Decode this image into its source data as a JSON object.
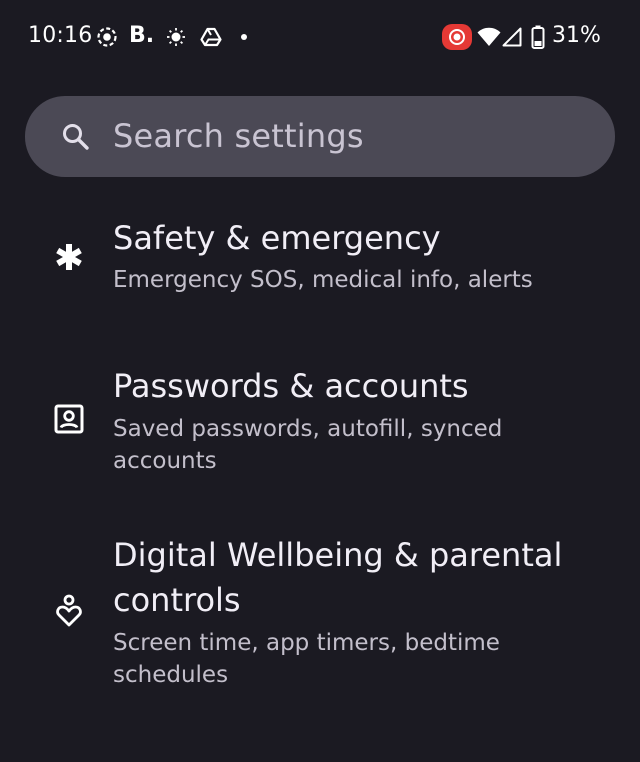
{
  "status_bar": {
    "time": "10:16",
    "app_letter": "B.",
    "battery_percent": "31%",
    "icons": [
      "record-circle-icon",
      "b-app-icon",
      "brightness-icon",
      "drive-icon",
      "notification-dot-icon",
      "screen-record-icon",
      "wifi-icon",
      "cell-signal-icon",
      "battery-icon"
    ]
  },
  "search": {
    "placeholder": "Search settings",
    "icon": "search-icon"
  },
  "items": [
    {
      "icon": "asterisk-icon",
      "title": "Safety & emergency",
      "subtitle_line1": "Emergency SOS, medical info, alerts",
      "subtitle_line2": ""
    },
    {
      "icon": "account-box-icon",
      "title": "Passwords & accounts",
      "subtitle_line1": "Saved passwords, autofill, synced",
      "subtitle_line2": "accounts"
    },
    {
      "icon": "wellbeing-icon",
      "title_line1": "Digital Wellbeing & parental",
      "title_line2": "controls",
      "subtitle_line1": "Screen time, app timers, bedtime",
      "subtitle_line2": "schedules"
    }
  ],
  "colors": {
    "background": "#1b1a22",
    "search_bg": "#4b4955",
    "record_red": "#e53935"
  }
}
